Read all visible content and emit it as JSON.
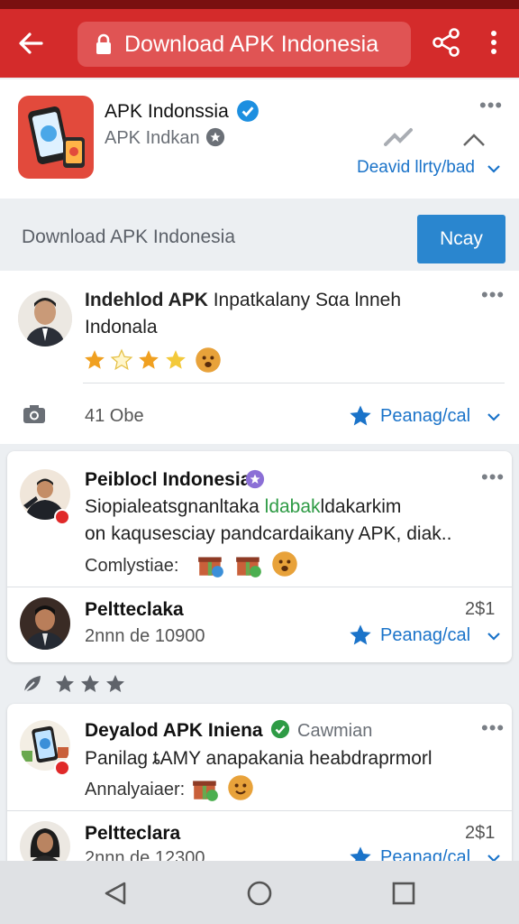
{
  "appbar": {
    "url": "Download APK Indonesia"
  },
  "app_header": {
    "name": "APK Indonssia",
    "developer": "APK Indkan",
    "action_link": "Deavid llrty/bad"
  },
  "banner": {
    "text": "Download APK Indonesia",
    "button_label": "Ncay"
  },
  "posts": [
    {
      "author": "Indehlod APK",
      "title_rest": " Inpatkalany Sαa lnneh",
      "title_line2": "Indonala",
      "rating": 3,
      "meta": "41 Obe",
      "action": "Peanag/cal"
    },
    {
      "author": "Peiblocl Indonesia",
      "body_line1": "Siopialeatsgnanltaka ",
      "body_green": "ldabak",
      "body_line1_end": "ldakarkim",
      "body_line2": "on kaqusesciay pandcardaikany APK, diak..",
      "label": "Comlystiae:"
    },
    {
      "author": "Peltteclaka",
      "meta": "2nnn de 10900",
      "count": "2$1",
      "action": "Peanag/cal"
    },
    {
      "author": "Deyalod APK Iniena",
      "author_extra": "Cawmian",
      "body_line1": "Panilag ȶAMY anapakania heabdraprmorl",
      "label": "Annalyaiaer:"
    },
    {
      "author": "Peltteclara",
      "meta": "2nnn de 12300",
      "count": "2$1",
      "action": "Peanag/cal"
    }
  ],
  "icons": {
    "verified": "verified-badge-icon",
    "share": "share-icon",
    "more": "more-vert-icon",
    "back": "back-arrow-icon",
    "lock": "lock-icon",
    "camera": "camera-icon",
    "star": "star-icon"
  },
  "colors": {
    "appbar": "#d42b2b",
    "accent_blue": "#1a73c9",
    "button_blue": "#2a86cf",
    "star_gold": "#f0a020"
  }
}
